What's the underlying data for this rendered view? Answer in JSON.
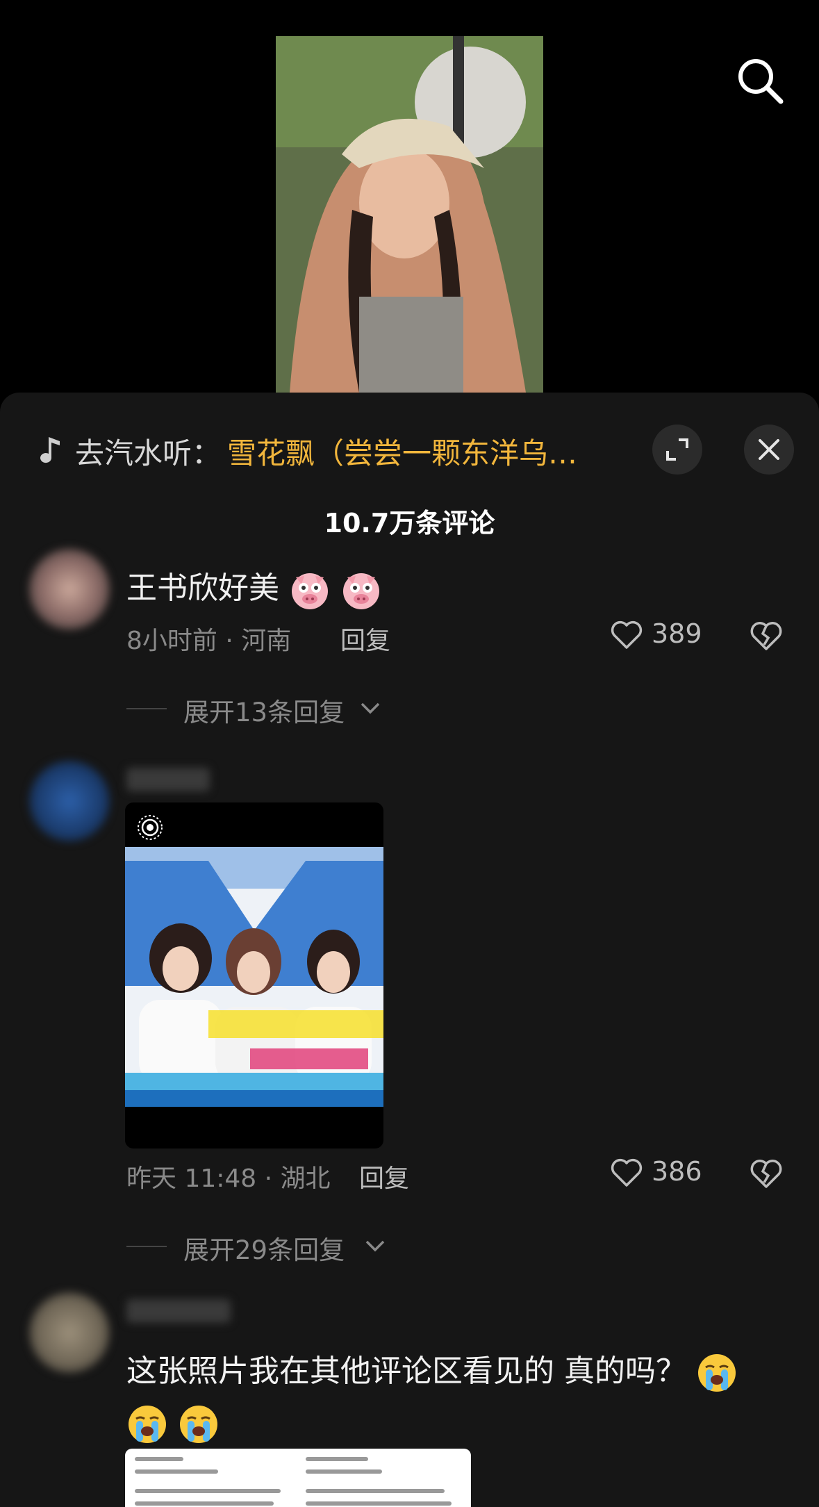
{
  "video": {
    "search_icon": "search-icon"
  },
  "music": {
    "note_icon": "music-note-icon",
    "prefix": "去汽水听：",
    "title": "雪花飘（尝尝一颗东洋乌…",
    "expand_icon": "expand-icon",
    "close_icon": "close-icon"
  },
  "comments_header": {
    "count_label": "10.7万条评论"
  },
  "comments": [
    {
      "text": "王书欣好美",
      "emojis": [
        "pig-face",
        "pig-face"
      ],
      "time_location": "8小时前 · 河南",
      "reply_label": "回复",
      "likes": "389",
      "expand_label": "展开13条回复"
    },
    {
      "image": true,
      "time_location": "昨天 11:48 · 湖北",
      "reply_label": "回复",
      "likes": "386",
      "expand_label": "展开29条回复"
    },
    {
      "text": "这张照片我在其他评论区看见的 真的吗？",
      "emojis": [
        "loudly-crying-face",
        "loudly-crying-face",
        "loudly-crying-face"
      ]
    }
  ],
  "colors": {
    "accent": "#f2b63c",
    "sheet_bg": "#161616",
    "muted_text": "#8a8a8a"
  }
}
